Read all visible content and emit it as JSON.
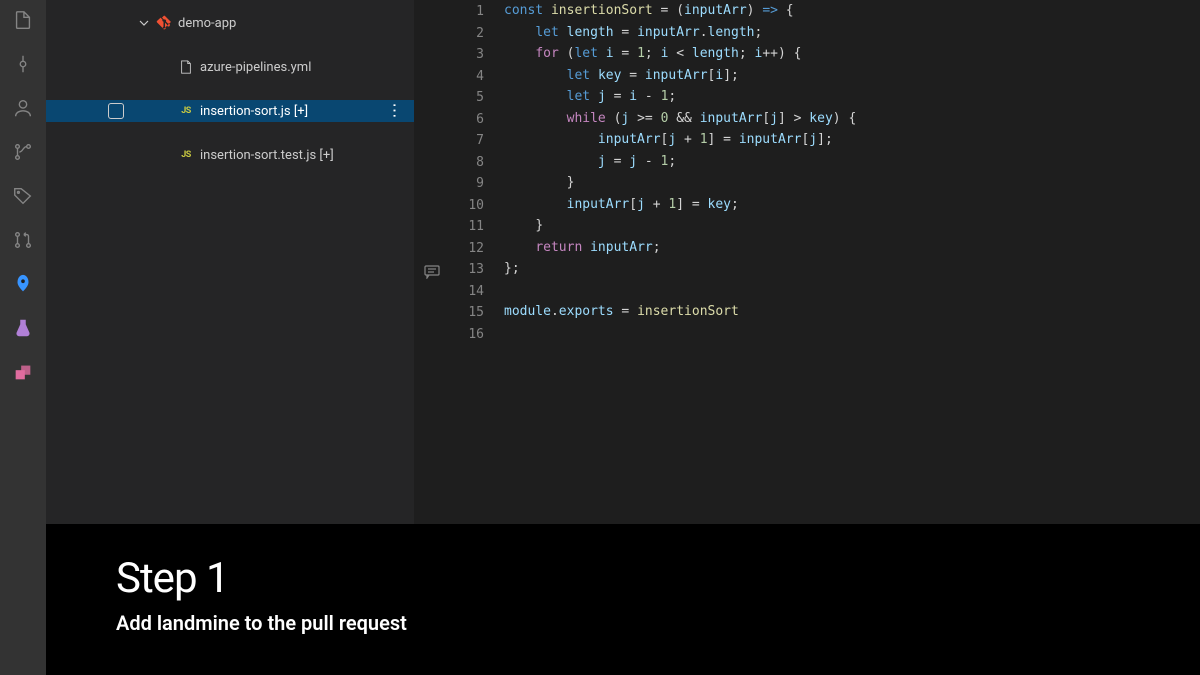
{
  "sidebar": {
    "folder_name": "demo-app",
    "files": [
      {
        "name": "azure-pipelines.yml",
        "type": "yml"
      },
      {
        "name": "insertion-sort.js [+]",
        "type": "js",
        "selected": true
      },
      {
        "name": "insertion-sort.test.js [+]",
        "type": "js"
      }
    ]
  },
  "editor": {
    "line_count": 16,
    "code_lines": [
      [
        [
          "tok-kw",
          "const"
        ],
        [
          "tok-plain",
          " "
        ],
        [
          "tok-fn",
          "insertionSort"
        ],
        [
          "tok-plain",
          " "
        ],
        [
          "tok-op",
          "="
        ],
        [
          "tok-plain",
          " "
        ],
        [
          "tok-op",
          "("
        ],
        [
          "tok-var",
          "inputArr"
        ],
        [
          "tok-op",
          ")"
        ],
        [
          "tok-plain",
          " "
        ],
        [
          "tok-kw",
          "=>"
        ],
        [
          "tok-plain",
          " "
        ],
        [
          "tok-op",
          "{"
        ]
      ],
      [
        [
          "tok-plain",
          "    "
        ],
        [
          "tok-kw",
          "let"
        ],
        [
          "tok-plain",
          " "
        ],
        [
          "tok-var",
          "length"
        ],
        [
          "tok-plain",
          " "
        ],
        [
          "tok-op",
          "="
        ],
        [
          "tok-plain",
          " "
        ],
        [
          "tok-var",
          "inputArr"
        ],
        [
          "tok-op",
          "."
        ],
        [
          "tok-prop",
          "length"
        ],
        [
          "tok-op",
          ";"
        ]
      ],
      [
        [
          "tok-plain",
          "    "
        ],
        [
          "tok-ctrl",
          "for"
        ],
        [
          "tok-plain",
          " "
        ],
        [
          "tok-op",
          "("
        ],
        [
          "tok-kw",
          "let"
        ],
        [
          "tok-plain",
          " "
        ],
        [
          "tok-var",
          "i"
        ],
        [
          "tok-plain",
          " "
        ],
        [
          "tok-op",
          "="
        ],
        [
          "tok-plain",
          " "
        ],
        [
          "tok-num",
          "1"
        ],
        [
          "tok-op",
          ";"
        ],
        [
          "tok-plain",
          " "
        ],
        [
          "tok-var",
          "i"
        ],
        [
          "tok-plain",
          " "
        ],
        [
          "tok-op",
          "<"
        ],
        [
          "tok-plain",
          " "
        ],
        [
          "tok-var",
          "length"
        ],
        [
          "tok-op",
          ";"
        ],
        [
          "tok-plain",
          " "
        ],
        [
          "tok-var",
          "i"
        ],
        [
          "tok-op",
          "++"
        ],
        [
          "tok-op",
          ")"
        ],
        [
          "tok-plain",
          " "
        ],
        [
          "tok-op",
          "{"
        ]
      ],
      [
        [
          "tok-plain",
          "        "
        ],
        [
          "tok-kw",
          "let"
        ],
        [
          "tok-plain",
          " "
        ],
        [
          "tok-var",
          "key"
        ],
        [
          "tok-plain",
          " "
        ],
        [
          "tok-op",
          "="
        ],
        [
          "tok-plain",
          " "
        ],
        [
          "tok-var",
          "inputArr"
        ],
        [
          "tok-op",
          "["
        ],
        [
          "tok-var",
          "i"
        ],
        [
          "tok-op",
          "]"
        ],
        [
          "tok-op",
          ";"
        ]
      ],
      [
        [
          "tok-plain",
          "        "
        ],
        [
          "tok-kw",
          "let"
        ],
        [
          "tok-plain",
          " "
        ],
        [
          "tok-var",
          "j"
        ],
        [
          "tok-plain",
          " "
        ],
        [
          "tok-op",
          "="
        ],
        [
          "tok-plain",
          " "
        ],
        [
          "tok-var",
          "i"
        ],
        [
          "tok-plain",
          " "
        ],
        [
          "tok-op",
          "-"
        ],
        [
          "tok-plain",
          " "
        ],
        [
          "tok-num",
          "1"
        ],
        [
          "tok-op",
          ";"
        ]
      ],
      [
        [
          "tok-plain",
          "        "
        ],
        [
          "tok-ctrl",
          "while"
        ],
        [
          "tok-plain",
          " "
        ],
        [
          "tok-op",
          "("
        ],
        [
          "tok-var",
          "j"
        ],
        [
          "tok-plain",
          " "
        ],
        [
          "tok-op",
          ">="
        ],
        [
          "tok-plain",
          " "
        ],
        [
          "tok-num",
          "0"
        ],
        [
          "tok-plain",
          " "
        ],
        [
          "tok-op",
          "&&"
        ],
        [
          "tok-plain",
          " "
        ],
        [
          "tok-var",
          "inputArr"
        ],
        [
          "tok-op",
          "["
        ],
        [
          "tok-var",
          "j"
        ],
        [
          "tok-op",
          "]"
        ],
        [
          "tok-plain",
          " "
        ],
        [
          "tok-op",
          ">"
        ],
        [
          "tok-plain",
          " "
        ],
        [
          "tok-var",
          "key"
        ],
        [
          "tok-op",
          ")"
        ],
        [
          "tok-plain",
          " "
        ],
        [
          "tok-op",
          "{"
        ]
      ],
      [
        [
          "tok-plain",
          "            "
        ],
        [
          "tok-var",
          "inputArr"
        ],
        [
          "tok-op",
          "["
        ],
        [
          "tok-var",
          "j"
        ],
        [
          "tok-plain",
          " "
        ],
        [
          "tok-op",
          "+"
        ],
        [
          "tok-plain",
          " "
        ],
        [
          "tok-num",
          "1"
        ],
        [
          "tok-op",
          "]"
        ],
        [
          "tok-plain",
          " "
        ],
        [
          "tok-op",
          "="
        ],
        [
          "tok-plain",
          " "
        ],
        [
          "tok-var",
          "inputArr"
        ],
        [
          "tok-op",
          "["
        ],
        [
          "tok-var",
          "j"
        ],
        [
          "tok-op",
          "]"
        ],
        [
          "tok-op",
          ";"
        ]
      ],
      [
        [
          "tok-plain",
          "            "
        ],
        [
          "tok-var",
          "j"
        ],
        [
          "tok-plain",
          " "
        ],
        [
          "tok-op",
          "="
        ],
        [
          "tok-plain",
          " "
        ],
        [
          "tok-var",
          "j"
        ],
        [
          "tok-plain",
          " "
        ],
        [
          "tok-op",
          "-"
        ],
        [
          "tok-plain",
          " "
        ],
        [
          "tok-num",
          "1"
        ],
        [
          "tok-op",
          ";"
        ]
      ],
      [
        [
          "tok-plain",
          "        "
        ],
        [
          "tok-op",
          "}"
        ]
      ],
      [
        [
          "tok-plain",
          "        "
        ],
        [
          "tok-var",
          "inputArr"
        ],
        [
          "tok-op",
          "["
        ],
        [
          "tok-var",
          "j"
        ],
        [
          "tok-plain",
          " "
        ],
        [
          "tok-op",
          "+"
        ],
        [
          "tok-plain",
          " "
        ],
        [
          "tok-num",
          "1"
        ],
        [
          "tok-op",
          "]"
        ],
        [
          "tok-plain",
          " "
        ],
        [
          "tok-op",
          "="
        ],
        [
          "tok-plain",
          " "
        ],
        [
          "tok-var",
          "key"
        ],
        [
          "tok-op",
          ";"
        ]
      ],
      [
        [
          "tok-plain",
          "    "
        ],
        [
          "tok-op",
          "}"
        ]
      ],
      [
        [
          "tok-plain",
          "    "
        ],
        [
          "tok-ctrl",
          "return"
        ],
        [
          "tok-plain",
          " "
        ],
        [
          "tok-var",
          "inputArr"
        ],
        [
          "tok-op",
          ";"
        ]
      ],
      [
        [
          "tok-op",
          "};"
        ]
      ],
      [],
      [
        [
          "tok-var",
          "module"
        ],
        [
          "tok-op",
          "."
        ],
        [
          "tok-prop",
          "exports"
        ],
        [
          "tok-plain",
          " "
        ],
        [
          "tok-op",
          "="
        ],
        [
          "tok-plain",
          " "
        ],
        [
          "tok-fn",
          "insertionSort"
        ]
      ],
      []
    ]
  },
  "overlay": {
    "title": "Step 1",
    "subtitle": "Add landmine to the pull request"
  }
}
